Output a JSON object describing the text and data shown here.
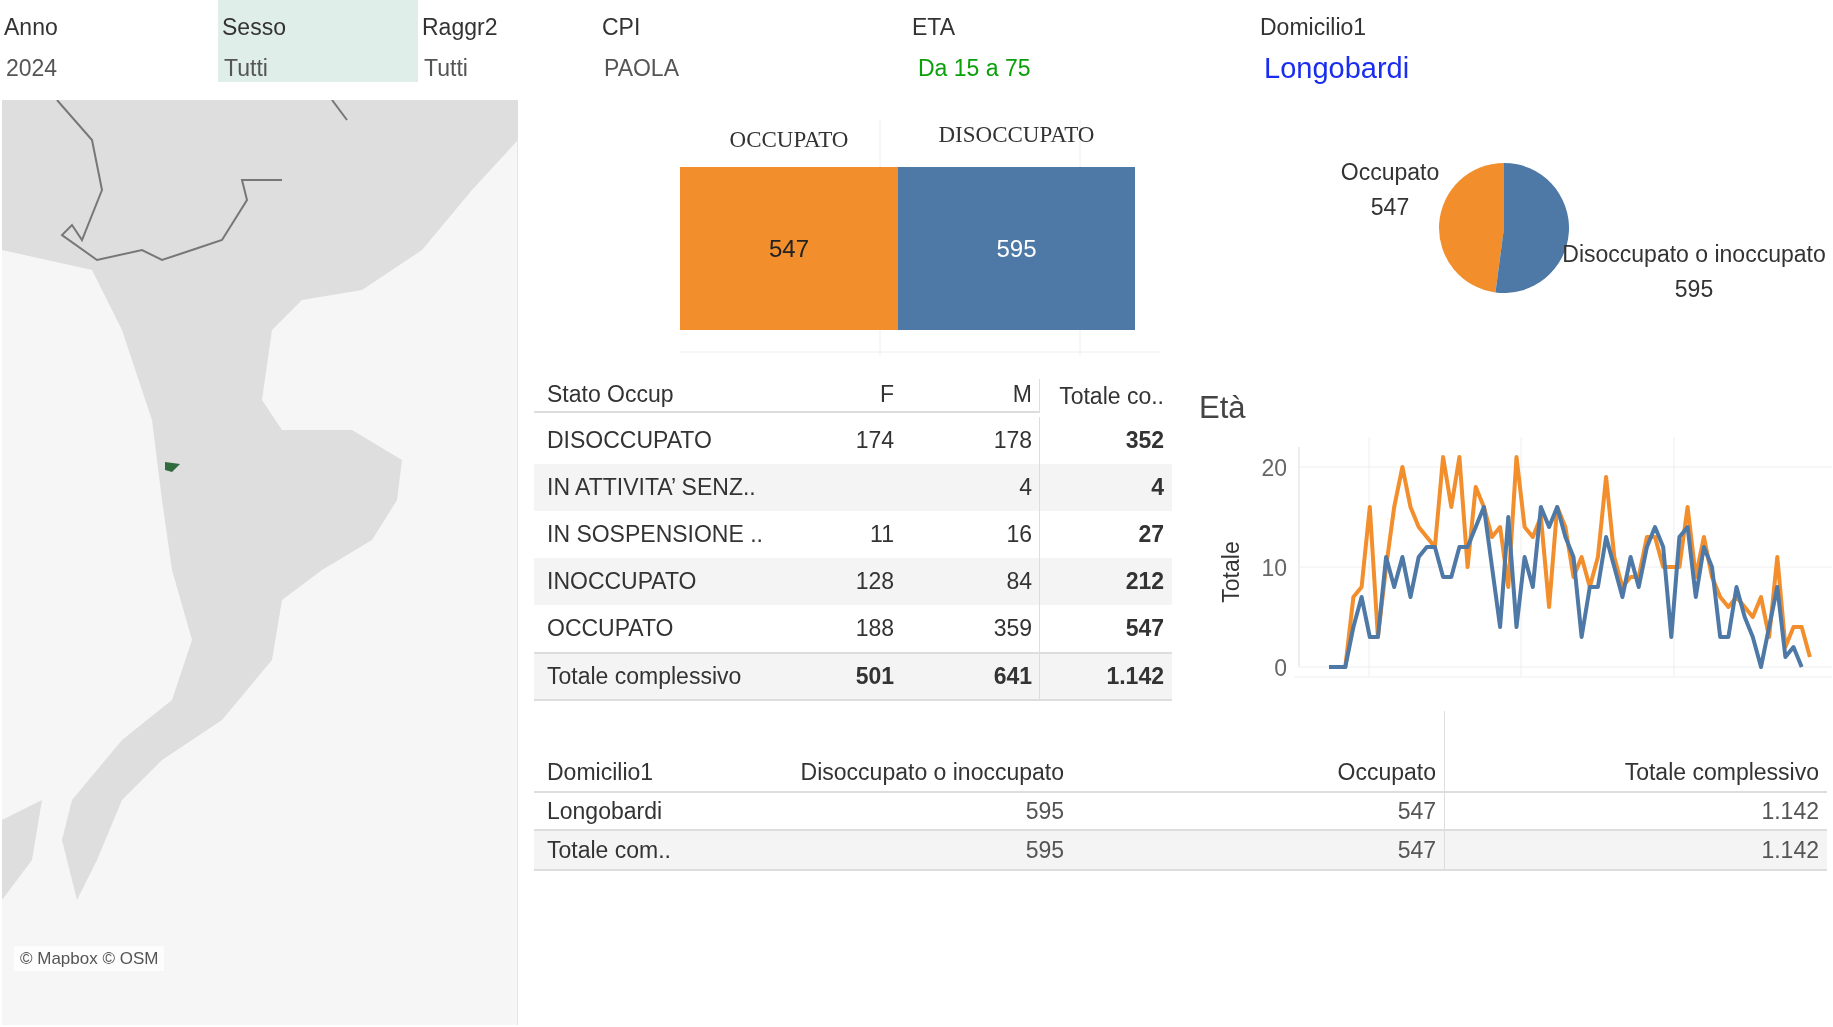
{
  "filters": [
    {
      "label": "Anno",
      "value": "2024",
      "selected": false,
      "kind": "plain"
    },
    {
      "label": "Sesso",
      "value": "Tutti",
      "selected": true,
      "kind": "plain"
    },
    {
      "label": "Raggr2",
      "value": "Tutti",
      "selected": false,
      "kind": "plain"
    },
    {
      "label": "CPI",
      "value": "PAOLA",
      "selected": false,
      "kind": "plain"
    },
    {
      "label": "ETA",
      "value": "Da 15 a 75",
      "selected": false,
      "kind": "range"
    },
    {
      "label": "Domicilio1",
      "value": "Longobardi",
      "selected": false,
      "kind": "link"
    }
  ],
  "map": {
    "attribution": "© Mapbox © OSM"
  },
  "bar_chart": {
    "chart_data": {
      "type": "bar",
      "orientation": "horizontal",
      "stacked": true,
      "data_labels": true,
      "series": [
        {
          "name": "OCCUPATO",
          "color": "#f28e2b",
          "values": [
            547
          ]
        },
        {
          "name": "DISOCCUPATO",
          "color": "#4e79a7",
          "values": [
            595
          ]
        }
      ]
    }
  },
  "pie_chart": {
    "chart_data": {
      "type": "pie",
      "data_labels": true,
      "categories": [
        "Occupato",
        "Disoccupato o inoccupato"
      ],
      "values": [
        547,
        595
      ],
      "colors": [
        "#f28e2b",
        "#4e79a7"
      ]
    }
  },
  "status_table": {
    "columns": [
      "Stato Occup",
      "F",
      "M",
      "Totale co.."
    ],
    "rows": [
      {
        "cells": [
          "DISOCCUPATO",
          "174",
          "178",
          "352"
        ]
      },
      {
        "cells": [
          "IN ATTIVITA’ SENZ..",
          "",
          "4",
          "4"
        ]
      },
      {
        "cells": [
          "IN SOSPENSIONE ..",
          "11",
          "16",
          "27"
        ]
      },
      {
        "cells": [
          "INOCCUPATO",
          "128",
          "84",
          "212"
        ]
      },
      {
        "cells": [
          "OCCUPATO",
          "188",
          "359",
          "547"
        ]
      }
    ],
    "total_row": [
      "Totale complessivo",
      "501",
      "641",
      "1.142"
    ]
  },
  "age_chart": {
    "title": "Età",
    "chart_data": {
      "type": "line",
      "grid": true,
      "ylabel": "Totale",
      "ylim": [
        0,
        22
      ],
      "yticks": [
        0,
        10,
        20
      ],
      "series": [
        {
          "color": "#f28e2b",
          "values": [
            0,
            0,
            0,
            7,
            8,
            16,
            3,
            10,
            16,
            20,
            16,
            14,
            13,
            12,
            21,
            16,
            21,
            10,
            18,
            16,
            13,
            14,
            8,
            21,
            14,
            13,
            15,
            6,
            16,
            14,
            9,
            11,
            8,
            11,
            19,
            11,
            8,
            9,
            9,
            13,
            13,
            10,
            10,
            10,
            16,
            9,
            13,
            9,
            7,
            6,
            7,
            6,
            5,
            7,
            3,
            11,
            2,
            4,
            4,
            1
          ]
        },
        {
          "color": "#4e79a7",
          "values": [
            0,
            0,
            0,
            4,
            7,
            3,
            3,
            11,
            8,
            11,
            7,
            11,
            12,
            12,
            9,
            9,
            12,
            12,
            14,
            16,
            10,
            4,
            15,
            4,
            11,
            8,
            16,
            14,
            16,
            13,
            11,
            3,
            8,
            8,
            13,
            10,
            7,
            11,
            8,
            12,
            14,
            12,
            3,
            13,
            14,
            7,
            12,
            10,
            3,
            3,
            8,
            5,
            3,
            0,
            4,
            8,
            1,
            2,
            0,
            null
          ]
        }
      ]
    }
  },
  "domicile_table": {
    "columns": [
      "Domicilio1",
      "Disoccupato o inoccupato",
      "Occupato",
      "Totale complessivo"
    ],
    "rows": [
      {
        "cells": [
          "Longobardi",
          "595",
          "547",
          "1.142"
        ]
      }
    ],
    "total_row": [
      "Totale com..",
      "595",
      "547",
      "1.142"
    ]
  }
}
